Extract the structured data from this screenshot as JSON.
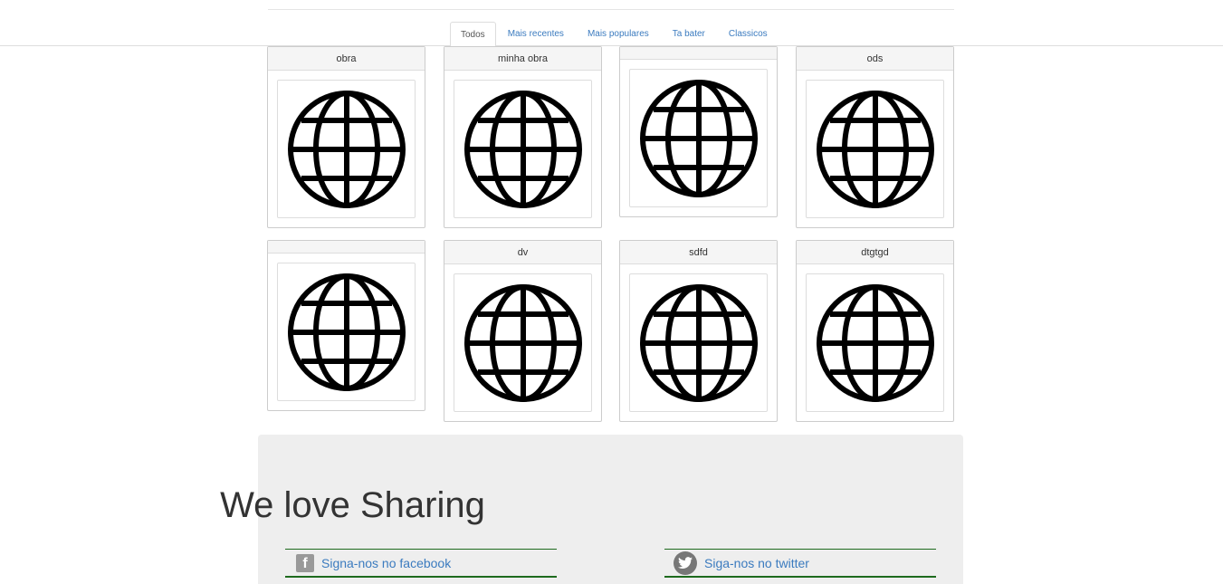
{
  "tabs": [
    "Todos",
    "Mais recentes",
    "Mais populares",
    "Ta bater",
    "Classicos"
  ],
  "cards": [
    {
      "title": "obra",
      "icon": "globe-icon"
    },
    {
      "title": "minha obra",
      "icon": "globe-icon"
    },
    {
      "title": "",
      "icon": "globe-icon"
    },
    {
      "title": "ods",
      "icon": "globe-icon"
    },
    {
      "title": "",
      "icon": "globe-icon"
    },
    {
      "title": "dv",
      "icon": "globe-icon"
    },
    {
      "title": "sdfd",
      "icon": "globe-icon"
    },
    {
      "title": "dtgtgd",
      "icon": "globe-icon"
    }
  ],
  "share": {
    "title": "We love Sharing",
    "facebook": {
      "label": "Signa-nos no facebook",
      "icon": "facebook-icon"
    },
    "twitter": {
      "label": "Siga-nos no twitter",
      "icon": "twitter-icon"
    }
  },
  "colors": {
    "link": "#3b7bbf",
    "accent_line": "#1d6a1d",
    "panel_bg": "#eeeeee"
  }
}
